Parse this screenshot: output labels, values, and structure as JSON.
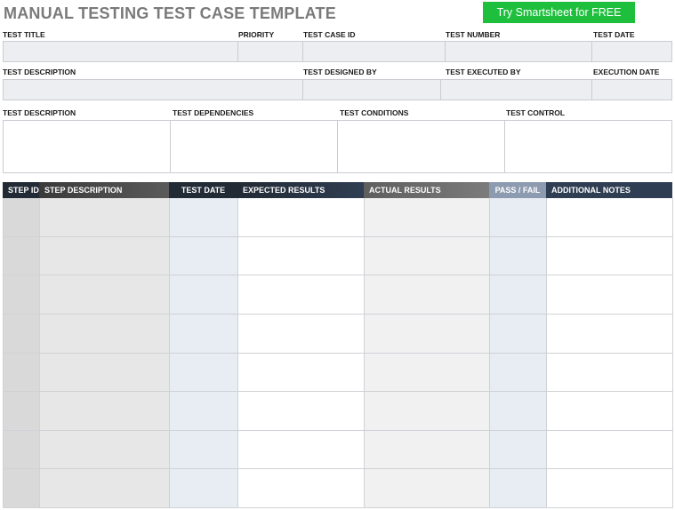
{
  "title": "MANUAL TESTING TEST CASE TEMPLATE",
  "cta_label": "Try Smartsheet for FREE",
  "row1_labels": {
    "test_title": "TEST TITLE",
    "priority": "PRIORITY",
    "test_case_id": "TEST CASE ID",
    "test_number": "TEST NUMBER",
    "test_date": "TEST DATE"
  },
  "row2_labels": {
    "test_description": "TEST DESCRIPTION",
    "test_designed_by": "TEST DESIGNED BY",
    "test_executed_by": "TEST EXECUTED BY",
    "execution_date": "EXECUTION DATE"
  },
  "row3_labels": {
    "test_description": "TEST DESCRIPTION",
    "test_dependencies": "TEST DEPENDENCIES",
    "test_conditions": "TEST CONDITIONS",
    "test_control": "TEST CONTROL"
  },
  "table": {
    "headers": {
      "step_id": "STEP ID",
      "step_description": "STEP DESCRIPTION",
      "test_date": "TEST DATE",
      "expected_results": "EXPECTED RESULTS",
      "actual_results": "ACTUAL RESULTS",
      "pass_fail": "PASS / FAIL",
      "additional_notes": "ADDITIONAL NOTES"
    },
    "row_count": 8
  },
  "colors": {
    "cta_bg": "#1fbf3e",
    "header_dark": "#222a35",
    "header_navy": "#2f3e52",
    "header_gray": "#6b6e72",
    "header_steel": "#8d9bb0"
  }
}
